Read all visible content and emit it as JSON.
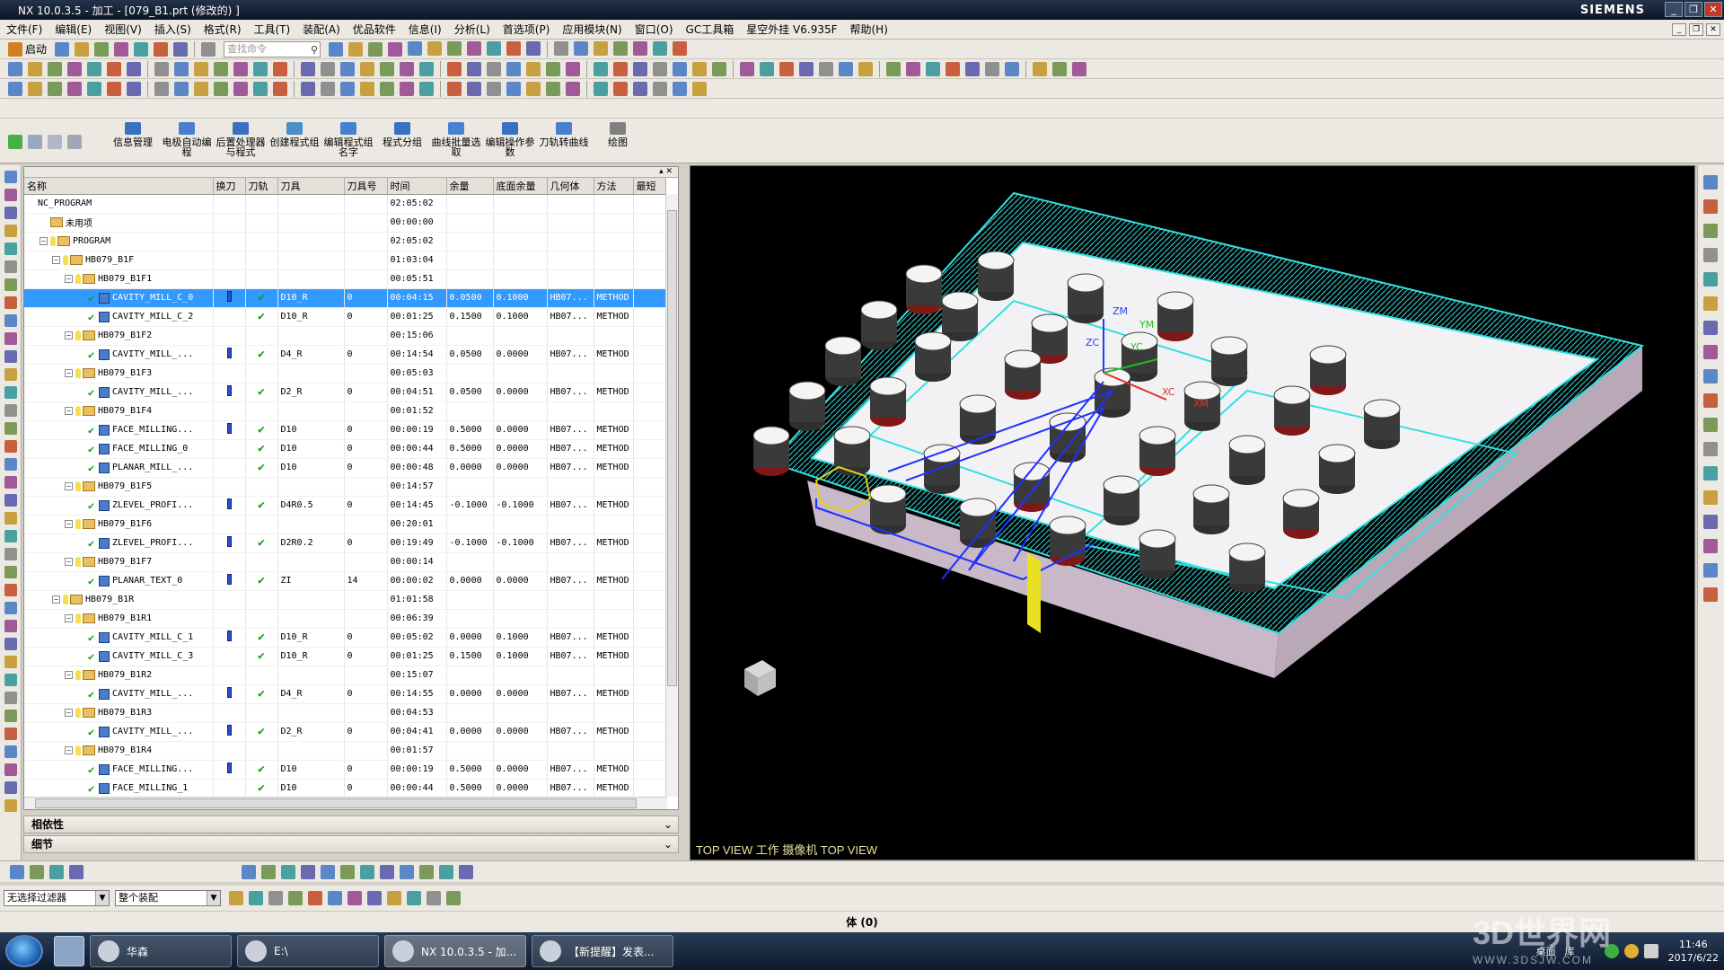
{
  "window": {
    "title": "NX 10.0.3.5 - 加工 - [079_B1.prt (修改的) ]",
    "brand": "SIEMENS",
    "buttons": [
      "_",
      "❐",
      "✕"
    ]
  },
  "menu": [
    "文件(F)",
    "编辑(E)",
    "视图(V)",
    "插入(S)",
    "格式(R)",
    "工具(T)",
    "装配(A)",
    "优品软件",
    "信息(I)",
    "分析(L)",
    "首选项(P)",
    "应用模块(N)",
    "窗口(O)",
    "GC工具箱",
    "星空外挂 V6.935F",
    "帮助(H)"
  ],
  "toolbar": {
    "start_label": "启动",
    "search_placeholder": "查找命令"
  },
  "big_buttons": [
    "信息管理",
    "电极自动编程",
    "后置处理器与程式",
    "创建程式组",
    "编辑程式组名字",
    "程式分组",
    "曲线批量选取",
    "编辑操作参数",
    "刀轨转曲线",
    "绘图"
  ],
  "navigator": {
    "columns": [
      "名称",
      "换刀",
      "刀轨",
      "刀具",
      "刀具号",
      "时间",
      "余量",
      "底面余量",
      "几何体",
      "方法",
      "最短"
    ],
    "rows": [
      {
        "level": 0,
        "name": "NC_PROGRAM",
        "kind": "root",
        "time": "02:05:02"
      },
      {
        "level": 1,
        "name": "未用项",
        "kind": "folder",
        "time": "00:00:00"
      },
      {
        "level": 1,
        "name": "PROGRAM",
        "kind": "group",
        "toggle": "−",
        "time": "02:05:02"
      },
      {
        "level": 2,
        "name": "HB079_B1F",
        "kind": "group",
        "toggle": "−",
        "time": "01:03:04"
      },
      {
        "level": 3,
        "name": "HB079_B1F1",
        "kind": "group",
        "toggle": "−",
        "time": "00:05:51"
      },
      {
        "level": 4,
        "name": "CAVITY_MILL_C_0",
        "kind": "op",
        "tc": true,
        "path": true,
        "tool": "D10_R",
        "tno": "0",
        "time": "00:04:15",
        "stock": "0.0500",
        "floor": "0.1000",
        "geom": "HB07...",
        "method": "METHOD",
        "selected": true
      },
      {
        "level": 4,
        "name": "CAVITY_MILL_C_2",
        "kind": "op",
        "tc": false,
        "path": true,
        "tool": "D10_R",
        "tno": "0",
        "time": "00:01:25",
        "stock": "0.1500",
        "floor": "0.1000",
        "geom": "HB07...",
        "method": "METHOD"
      },
      {
        "level": 3,
        "name": "HB079_B1F2",
        "kind": "group",
        "toggle": "−",
        "time": "00:15:06"
      },
      {
        "level": 4,
        "name": "CAVITY_MILL_...",
        "kind": "op",
        "tc": true,
        "path": true,
        "tool": "D4_R",
        "tno": "0",
        "time": "00:14:54",
        "stock": "0.0500",
        "floor": "0.0000",
        "geom": "HB07...",
        "method": "METHOD"
      },
      {
        "level": 3,
        "name": "HB079_B1F3",
        "kind": "group",
        "toggle": "−",
        "time": "00:05:03"
      },
      {
        "level": 4,
        "name": "CAVITY_MILL_...",
        "kind": "op",
        "tc": true,
        "path": true,
        "tool": "D2_R",
        "tno": "0",
        "time": "00:04:51",
        "stock": "0.0500",
        "floor": "0.0000",
        "geom": "HB07...",
        "method": "METHOD"
      },
      {
        "level": 3,
        "name": "HB079_B1F4",
        "kind": "group",
        "toggle": "−",
        "time": "00:01:52"
      },
      {
        "level": 4,
        "name": "FACE_MILLING...",
        "kind": "op",
        "tc": true,
        "path": true,
        "tool": "D10",
        "tno": "0",
        "time": "00:00:19",
        "stock": "0.5000",
        "floor": "0.0000",
        "geom": "HB07...",
        "method": "METHOD"
      },
      {
        "level": 4,
        "name": "FACE_MILLING_0",
        "kind": "op",
        "tc": false,
        "path": true,
        "tool": "D10",
        "tno": "0",
        "time": "00:00:44",
        "stock": "0.5000",
        "floor": "0.0000",
        "geom": "HB07...",
        "method": "METHOD"
      },
      {
        "level": 4,
        "name": "PLANAR_MILL_...",
        "kind": "op",
        "tc": false,
        "path": true,
        "tool": "D10",
        "tno": "0",
        "time": "00:00:48",
        "stock": "0.0000",
        "floor": "0.0000",
        "geom": "HB07...",
        "method": "METHOD"
      },
      {
        "level": 3,
        "name": "HB079_B1F5",
        "kind": "group",
        "toggle": "−",
        "time": "00:14:57"
      },
      {
        "level": 4,
        "name": "ZLEVEL_PROFI...",
        "kind": "op",
        "tc": true,
        "path": true,
        "tool": "D4R0.5",
        "tno": "0",
        "time": "00:14:45",
        "stock": "-0.1000",
        "floor": "-0.1000",
        "geom": "HB07...",
        "method": "METHOD"
      },
      {
        "level": 3,
        "name": "HB079_B1F6",
        "kind": "group",
        "toggle": "−",
        "time": "00:20:01"
      },
      {
        "level": 4,
        "name": "ZLEVEL_PROFI...",
        "kind": "op",
        "tc": true,
        "path": true,
        "tool": "D2R0.2",
        "tno": "0",
        "time": "00:19:49",
        "stock": "-0.1000",
        "floor": "-0.1000",
        "geom": "HB07...",
        "method": "METHOD"
      },
      {
        "level": 3,
        "name": "HB079_B1F7",
        "kind": "group",
        "toggle": "−",
        "time": "00:00:14"
      },
      {
        "level": 4,
        "name": "PLANAR_TEXT_0",
        "kind": "op",
        "tc": true,
        "path": true,
        "tool": "ZI",
        "tno": "14",
        "time": "00:00:02",
        "stock": "0.0000",
        "floor": "0.0000",
        "geom": "HB07...",
        "method": "METHOD"
      },
      {
        "level": 2,
        "name": "HB079_B1R",
        "kind": "group",
        "toggle": "−",
        "time": "01:01:58"
      },
      {
        "level": 3,
        "name": "HB079_B1R1",
        "kind": "group",
        "toggle": "−",
        "time": "00:06:39"
      },
      {
        "level": 4,
        "name": "CAVITY_MILL_C_1",
        "kind": "op",
        "tc": true,
        "path": true,
        "tool": "D10_R",
        "tno": "0",
        "time": "00:05:02",
        "stock": "0.0000",
        "floor": "0.1000",
        "geom": "HB07...",
        "method": "METHOD"
      },
      {
        "level": 4,
        "name": "CAVITY_MILL_C_3",
        "kind": "op",
        "tc": false,
        "path": true,
        "tool": "D10_R",
        "tno": "0",
        "time": "00:01:25",
        "stock": "0.1500",
        "floor": "0.1000",
        "geom": "HB07...",
        "method": "METHOD"
      },
      {
        "level": 3,
        "name": "HB079_B1R2",
        "kind": "group",
        "toggle": "−",
        "time": "00:15:07"
      },
      {
        "level": 4,
        "name": "CAVITY_MILL_...",
        "kind": "op",
        "tc": true,
        "path": true,
        "tool": "D4_R",
        "tno": "0",
        "time": "00:14:55",
        "stock": "0.0000",
        "floor": "0.0000",
        "geom": "HB07...",
        "method": "METHOD"
      },
      {
        "level": 3,
        "name": "HB079_B1R3",
        "kind": "group",
        "toggle": "−",
        "time": "00:04:53"
      },
      {
        "level": 4,
        "name": "CAVITY_MILL_...",
        "kind": "op",
        "tc": true,
        "path": true,
        "tool": "D2_R",
        "tno": "0",
        "time": "00:04:41",
        "stock": "0.0000",
        "floor": "0.0000",
        "geom": "HB07...",
        "method": "METHOD"
      },
      {
        "level": 3,
        "name": "HB079_B1R4",
        "kind": "group",
        "toggle": "−",
        "time": "00:01:57"
      },
      {
        "level": 4,
        "name": "FACE_MILLING...",
        "kind": "op",
        "tc": true,
        "path": true,
        "tool": "D10",
        "tno": "0",
        "time": "00:00:19",
        "stock": "0.5000",
        "floor": "0.0000",
        "geom": "HB07...",
        "method": "METHOD"
      },
      {
        "level": 4,
        "name": "FACE_MILLING_1",
        "kind": "op",
        "tc": false,
        "path": true,
        "tool": "D10",
        "tno": "0",
        "time": "00:00:44",
        "stock": "0.5000",
        "floor": "0.0000",
        "geom": "HB07...",
        "method": "METHOD"
      }
    ]
  },
  "panels": {
    "dependencies": "相依性",
    "details": "细节"
  },
  "viewport": {
    "label": "TOP VIEW 工作 摄像机 TOP VIEW",
    "axis_labels": [
      "ZM",
      "YM",
      "ZC",
      "YC",
      "XC",
      "XM"
    ]
  },
  "filters": {
    "type_filter": "无选择过滤器",
    "scope_filter": "整个装配"
  },
  "status": {
    "text": "体 (0)"
  },
  "taskbar": {
    "tasks": [
      "华森",
      "E:\\",
      "NX 10.0.3.5 - 加...",
      "【新提醒】发表..."
    ],
    "tray_labels": [
      "桌面",
      "库"
    ],
    "time": "11:46",
    "date": "2017/6/22"
  },
  "watermark": {
    "title": "3D世界网",
    "url": "WWW.3DSJW.COM"
  },
  "colors": {
    "titlebar": "#0d1626",
    "selection": "#3399ff",
    "toolpath": "#33e0e0",
    "viewport_bg": "#000000"
  }
}
